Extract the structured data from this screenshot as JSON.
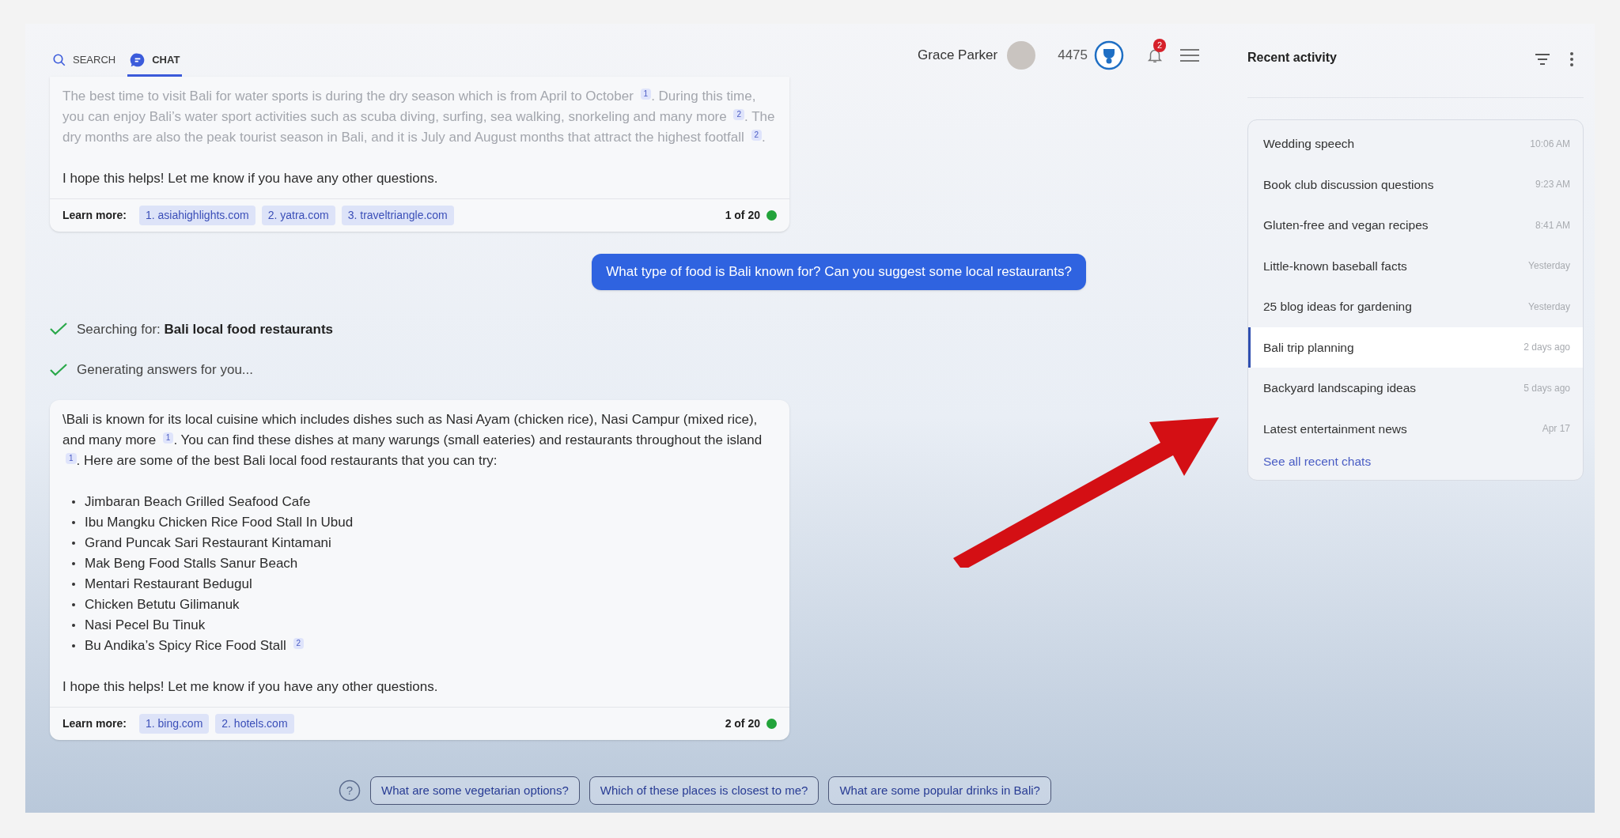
{
  "tabs": [
    {
      "label": "SEARCH",
      "kind": "search",
      "selected": false
    },
    {
      "label": "CHAT",
      "kind": "chat",
      "selected": true
    }
  ],
  "user": {
    "name": "Grace Parker",
    "points": "4475",
    "notifications": "2"
  },
  "messages": [
    {
      "kind": "answer",
      "paragraphs": [
        "The best time to visit Bali for water sports is during the dry season which is from April to October $^{1}$. During this time, you can enjoy Bali’s water sport activities such as scuba diving, surfing, sea walking, snorkeling and many more $^{2}$. The dry months are also the peak tourist season in Bali, and it is July and August months that attract the highest footfall $^{2}$."
      ],
      "closing": "I hope this helps! Let me know if you have any other questions.",
      "faded": true,
      "learn_more_label": "Learn more:",
      "sources": [
        "1. asiahighlights.com",
        "2. yatra.com",
        "3. traveltriangle.com"
      ],
      "counter": "1 of 20"
    },
    {
      "kind": "question",
      "text": "What type of food is Bali known for? Can you suggest some local restaurants?"
    },
    {
      "kind": "status",
      "done": true,
      "text": "Searching for: **Bali local food restaurants**"
    },
    {
      "kind": "status",
      "done": true,
      "text": "Generating answers for you..."
    },
    {
      "kind": "answer",
      "paragraphs": [
        "\\Bali is known for its local cuisine which includes dishes such as Nasi Ayam (chicken rice), Nasi Campur (mixed rice), and many more $^{1}$. You can find these dishes at many warungs (small eateries) and restaurants throughout the island $^{1}$. Here are some of the best Bali local food restaurants that you can try:"
      ],
      "list": [
        "Jimbaran Beach Grilled Seafood Cafe",
        "Ibu Mangku Chicken Rice Food Stall In Ubud",
        "Grand Puncak Sari Restaurant Kintamani",
        "Mak Beng Food Stalls Sanur Beach",
        "Mentari Restaurant Bedugul",
        "Chicken Betutu Gilimanuk",
        "Nasi Pecel Bu Tinuk",
        "Bu Andika’s Spicy Rice Food Stall $^{2}$"
      ],
      "closing": "I hope this helps! Let me know if you have any other questions.",
      "faded": false,
      "learn_more_label": "Learn more:",
      "sources": [
        "1. bing.com",
        "2. hotels.com"
      ],
      "counter": "2 of 20"
    }
  ],
  "help_label": "?",
  "suggestions": [
    "What are some vegetarian options?",
    "Which of these places is closest to me?",
    "What are some popular drinks in Bali?"
  ],
  "recent": {
    "title": "Recent activity",
    "items": [
      {
        "title": "Wedding speech",
        "time": "10:06 AM",
        "selected": false
      },
      {
        "title": "Book club discussion questions",
        "time": "9:23 AM",
        "selected": false
      },
      {
        "title": "Gluten-free and vegan recipes",
        "time": "8:41 AM",
        "selected": false
      },
      {
        "title": "Little-known baseball facts",
        "time": "Yesterday",
        "selected": false
      },
      {
        "title": "25 blog ideas for gardening",
        "time": "Yesterday",
        "selected": false
      },
      {
        "title": "Bali trip planning",
        "time": "2 days ago",
        "selected": true
      },
      {
        "title": "Backyard landscaping ideas",
        "time": "5 days ago",
        "selected": false
      },
      {
        "title": "Latest entertainment news",
        "time": "Apr 17",
        "selected": false
      }
    ],
    "see_all": "See all recent chats"
  }
}
